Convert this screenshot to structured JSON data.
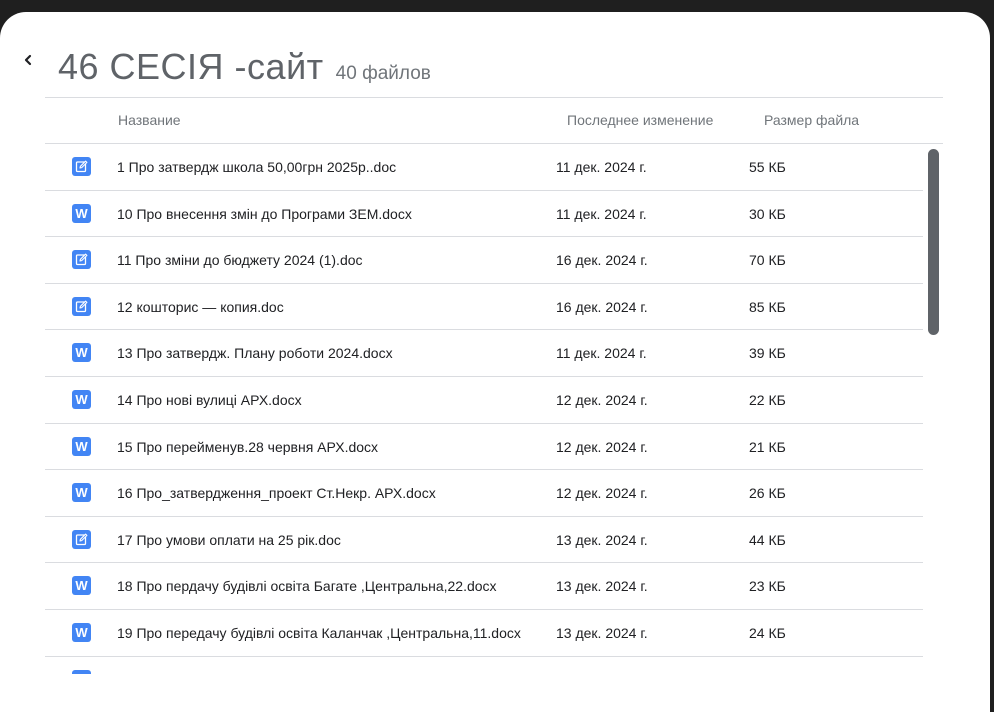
{
  "header": {
    "title": "46 СЕСІЯ -сайт",
    "file_count": "40 файлов"
  },
  "columns": {
    "name": "Название",
    "modified": "Последнее изменение",
    "size": "Размер файла"
  },
  "icons": {
    "doc": "edit-document-icon",
    "docx": "word-document-icon",
    "back": "chevron-left-icon"
  },
  "colors": {
    "file_icon_blue": "#4285f4",
    "scrollbar": "#5f6368"
  },
  "files": [
    {
      "type": "doc",
      "name": "1 Про затвердж школа 50,00грн 2025р..doc",
      "modified": "11 дек. 2024 г.",
      "size": "55 КБ"
    },
    {
      "type": "docx",
      "name": "10 Про внесення змін до Програми ЗЕМ.docx",
      "modified": "11 дек. 2024 г.",
      "size": "30 КБ"
    },
    {
      "type": "doc",
      "name": "11 Про зміни до бюджету 2024 (1).doc",
      "modified": "16 дек. 2024 г.",
      "size": "70 КБ"
    },
    {
      "type": "doc",
      "name": "12 кошторис — копия.doc",
      "modified": "16 дек. 2024 г.",
      "size": "85 КБ"
    },
    {
      "type": "docx",
      "name": "13 Про затвердж. Плану роботи 2024.docx",
      "modified": "11 дек. 2024 г.",
      "size": "39 КБ"
    },
    {
      "type": "docx",
      "name": "14 Про нові вулиці АРХ.docx",
      "modified": "12 дек. 2024 г.",
      "size": "22 КБ"
    },
    {
      "type": "docx",
      "name": "15 Про перейменув.28 червня АРХ.docx",
      "modified": "12 дек. 2024 г.",
      "size": "21 КБ"
    },
    {
      "type": "docx",
      "name": "16 Про_затвердження_проект Ст.Некр. АРХ.docx",
      "modified": "12 дек. 2024 г.",
      "size": "26 КБ"
    },
    {
      "type": "doc",
      "name": "17 Про умови оплати на 25 рік.doc",
      "modified": "13 дек. 2024 г.",
      "size": "44 КБ"
    },
    {
      "type": "docx",
      "name": "18 Про пердачу будівлі освіта Багате ,Центральна,22.docx",
      "modified": "13 дек. 2024 г.",
      "size": "23 КБ"
    },
    {
      "type": "docx",
      "name": "19 Про передачу будівлі освіта Каланчак ,Центральна,11.docx",
      "modified": "13 дек. 2024 г.",
      "size": "24 КБ"
    }
  ]
}
